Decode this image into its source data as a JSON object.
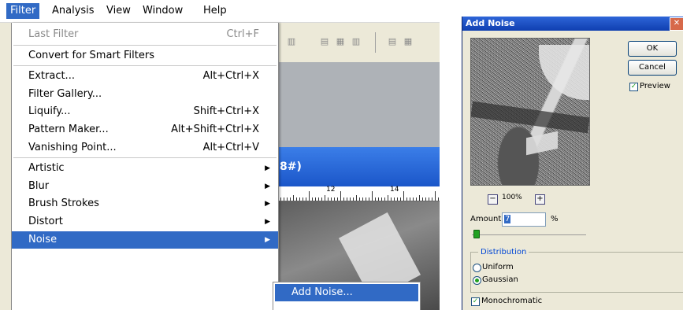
{
  "menubar": {
    "items": [
      "Filter",
      "Analysis",
      "View",
      "Window",
      "Help"
    ]
  },
  "filter_menu": {
    "groups": [
      [
        {
          "label": "Last Filter",
          "shortcut": "Ctrl+F",
          "disabled": true
        }
      ],
      [
        {
          "label": "Convert for Smart Filters",
          "shortcut": ""
        }
      ],
      [
        {
          "label": "Extract...",
          "shortcut": "Alt+Ctrl+X"
        },
        {
          "label": "Filter Gallery...",
          "shortcut": ""
        },
        {
          "label": "Liquify...",
          "shortcut": "Shift+Ctrl+X"
        },
        {
          "label": "Pattern Maker...",
          "shortcut": "Alt+Shift+Ctrl+X"
        },
        {
          "label": "Vanishing Point...",
          "shortcut": "Alt+Ctrl+V"
        }
      ],
      [
        {
          "label": "Artistic",
          "submenu": true
        },
        {
          "label": "Blur",
          "submenu": true
        },
        {
          "label": "Brush Strokes",
          "submenu": true
        },
        {
          "label": "Distort",
          "submenu": true
        },
        {
          "label": "Noise",
          "submenu": true,
          "highlighted": true
        }
      ]
    ]
  },
  "noise_submenu": {
    "items": [
      "Add Noise..."
    ]
  },
  "document": {
    "title_fragment": "8#)",
    "ruler_labels": [
      "12",
      "14"
    ]
  },
  "dialog": {
    "title": "Add Noise",
    "close_glyph": "✕",
    "ok_label": "OK",
    "cancel_label": "Cancel",
    "preview_label": "Preview",
    "preview_checked": true,
    "zoom_out_glyph": "−",
    "zoom_level": "100%",
    "zoom_in_glyph": "+",
    "amount_label": "Amount:",
    "amount_value": "7",
    "amount_unit": "%",
    "amount_slider_fraction": 0.02,
    "distribution_label": "Distribution",
    "uniform_label": "Uniform",
    "gaussian_label": "Gaussian",
    "selected_distribution": "Gaussian",
    "monochromatic_label": "Monochromatic",
    "monochromatic_checked": true
  },
  "colors": {
    "highlight": "#316ac5",
    "title_bar": "#1b56c9",
    "dialog_bg": "#ece9d8"
  }
}
